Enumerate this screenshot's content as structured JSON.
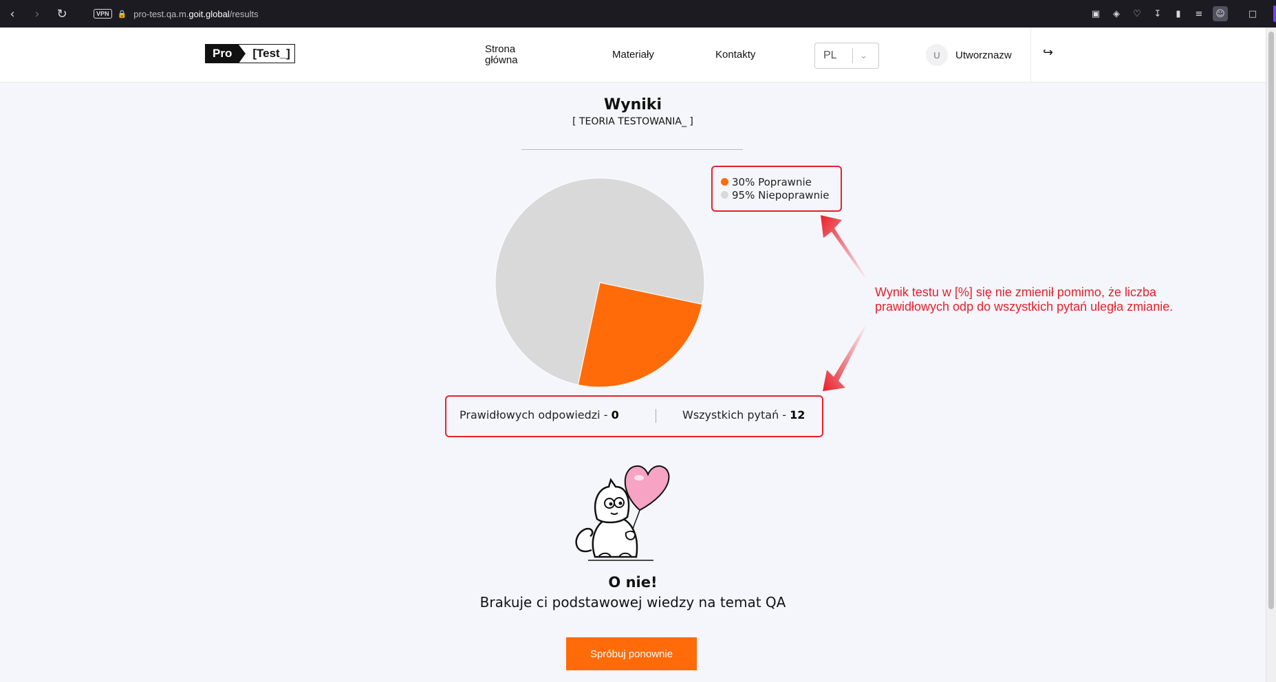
{
  "browser": {
    "url_host": "pro-test.qa.m.",
    "url_domain": "goit.global",
    "url_path": "/results",
    "vpn_label": "VPN"
  },
  "header": {
    "logo_pro": "Pro",
    "logo_test": "[Test_]",
    "nav": {
      "home_line1": "Strona",
      "home_line2": "główna",
      "materials": "Materiały",
      "contacts": "Kontakty"
    },
    "language": "PL",
    "avatar_initial": "U",
    "username": "Utworznazw"
  },
  "results": {
    "title": "Wyniki",
    "subtitle": "[ TEORIA TESTOWANIA_ ]",
    "legend": [
      {
        "label": "30% Poprawnie",
        "color": "#ff6b09"
      },
      {
        "label": "95% Niepoprawnie",
        "color": "#d9d9d9"
      }
    ],
    "correct_label": "Prawidłowych odpowiedzi - ",
    "correct_value": "0",
    "total_label": "Wszystkich pytań - ",
    "total_value": "12",
    "heading": "O nie!",
    "message": "Brakuje ci podstawowej wiedzy na temat QA",
    "retry_label": "Spróbuj ponownie"
  },
  "chart_data": {
    "type": "pie",
    "categories": [
      "Poprawnie",
      "Niepoprawnie"
    ],
    "values": [
      25,
      75
    ],
    "colors": [
      "#ff6b09",
      "#d9d9d9"
    ]
  },
  "annotation": {
    "line1": "Wynik testu w [%] się nie zmienił pomimo, że liczba",
    "line2": "prawidłowych odp do wszystkich pytań uległa zmianie."
  },
  "colors": {
    "accent": "#ff6b09",
    "annotation_red": "#e8202a"
  }
}
